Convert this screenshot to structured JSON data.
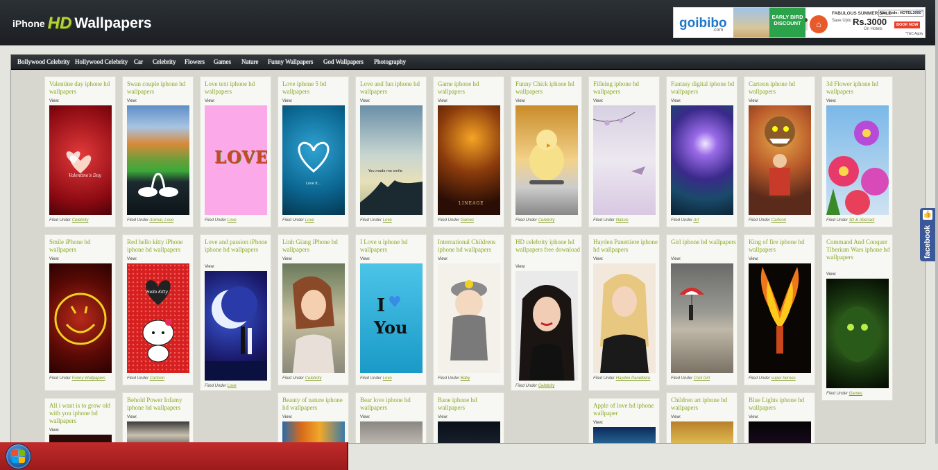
{
  "header": {
    "logo": {
      "part1": "iPhone",
      "part2": "HD",
      "part3": "Wallpapers"
    }
  },
  "ad": {
    "brand": "goibibo",
    "brand_domain": ".com",
    "badge": "EARLY BIRD DISCOUNT",
    "sale": "FABULOUS SUMMER SALE",
    "save": "Save Upto",
    "price": "Rs.3000",
    "on_hotels": "On Hotels",
    "code": "Use code: HOTEL3000",
    "book": "BOOK NOW",
    "tc": "*T&C Apply",
    "adchoice": "▷×"
  },
  "nav": [
    "Bollywood Celebrity",
    "Hollywood Celebrity",
    "Car",
    "Celebrity",
    "Flowers",
    "Games",
    "Nature",
    "Funny Wallpapers",
    "God Wallpapers",
    "Photography"
  ],
  "view_label": "View:",
  "filed_label": "Filed Under",
  "cards": [
    {
      "title": "Valentine day iphone hd wallpapers",
      "cat": "Celebrity"
    },
    {
      "title": "Swan couple iphone hd wallpapers",
      "cat": "Animal, Love"
    },
    {
      "title": "Love text iphone hd wallpapers",
      "cat": "Love"
    },
    {
      "title": "Love iphone 5 hd wallpapers",
      "cat": "Love"
    },
    {
      "title": "Love and fun iphone hd wallpapers",
      "cat": "Love"
    },
    {
      "title": "Game iphone hd wallpapers",
      "cat": "Games"
    },
    {
      "title": "Funny Chick iphone hd wallpapers",
      "cat": "Celebrity"
    },
    {
      "title": "Filleing iphone hd wallpapers",
      "cat": "Nature"
    },
    {
      "title": "Fantasy digital iphone hd wallpapers",
      "cat": "Art"
    },
    {
      "title": "Cartoon iphone hd wallpapers",
      "cat": "Cartoon"
    },
    {
      "title": "3d Flower iphone hd wallpapers",
      "cat": "3D & Abstract"
    },
    {
      "title": "Smile iPhone hd wallpapers",
      "cat": "Funny Wallpapers"
    },
    {
      "title": "Red hello kitty iPhone iphone hd wallpapers",
      "cat": "Cartoon"
    },
    {
      "title": "Love and passion iPhone iphone hd wallpapers",
      "cat": "Love"
    },
    {
      "title": "Linh Giang iPhone hd wallpapers",
      "cat": "Celebrity"
    },
    {
      "title": "I Love u iphone hd wallpapers",
      "cat": "Love"
    },
    {
      "title": "International Childrens iphone hd wallpapers",
      "cat": "Baby"
    },
    {
      "title": "HD celebrity iphone hd wallpapers free download",
      "cat": "Celebrity"
    },
    {
      "title": "Hayden Panettiere iphone hd wallpapers",
      "cat": "Hayden Panettiere"
    },
    {
      "title": "Girl iphone hd wallpapers",
      "cat": "Cool Girl"
    },
    {
      "title": "King of fire iphone hd wallpapers",
      "cat": "super heroes"
    },
    {
      "title": "Command And Conquer Tiberium Wars iphone hd wallpapers",
      "cat": "Games"
    },
    {
      "title": "All i want is to grow old with you iphone hd wallpapers",
      "cat": ""
    },
    {
      "title": "Behold Power Infamy iphone hd wallpapers",
      "cat": ""
    },
    {
      "title": "Beauty of nature iphone hd wallpapers",
      "cat": ""
    },
    {
      "title": "Bear love iphone hd wallpapers",
      "cat": ""
    },
    {
      "title": "Bane iphone hd wallpapers",
      "cat": ""
    },
    {
      "title": "Apple of love hd iphone wallpaper",
      "cat": ""
    },
    {
      "title": "Children art iphone hd wallpapers",
      "cat": ""
    },
    {
      "title": "Blue Lights iphone hd wallpapers",
      "cat": ""
    }
  ],
  "image_text": {
    "love_letters": "LOVE",
    "i_you_1": "I",
    "i_you_2": "You",
    "kitty": "Hello Kitty",
    "lineage": "LINEAGE",
    "made_me": "You made me smile",
    "love_it": "Love it...",
    "heart_text": "Valentine's Day"
  },
  "facebook": {
    "label": "facebook",
    "thumb": "👍"
  }
}
